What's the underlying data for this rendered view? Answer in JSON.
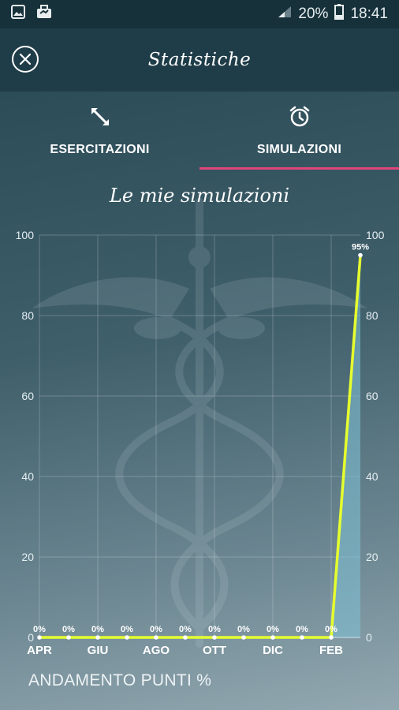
{
  "status_bar": {
    "battery": "20%",
    "time": "18:41",
    "icons": [
      "image-icon",
      "briefcase-notification-icon",
      "signal-icon",
      "battery-icon"
    ]
  },
  "header": {
    "title": "Statistiche",
    "close_icon": "close-icon"
  },
  "tabs": [
    {
      "label": "ESERCITAZIONI",
      "icon": "arrows-diagonal-icon",
      "selected": false
    },
    {
      "label": "SIMULAZIONI",
      "icon": "alarm-clock-icon",
      "selected": true
    }
  ],
  "section_title": "Le mie simulazioni",
  "footer_label": "ANDAMENTO PUNTI %",
  "colors": {
    "accent": "#e0457b",
    "line": "#e6ff2e",
    "area": "#7fc3d7"
  },
  "chart_data": {
    "type": "line",
    "title": "Le mie simulazioni",
    "xlabel": "ANDAMENTO PUNTI %",
    "ylabel": "",
    "ylim": [
      0,
      100
    ],
    "yticks": [
      "0",
      "20",
      "40",
      "60",
      "80",
      "100"
    ],
    "x_labels": [
      "APR",
      "",
      "GIU",
      "",
      "AGO",
      "",
      "OTT",
      "",
      "DIC",
      "",
      "FEB",
      ""
    ],
    "series": [
      {
        "values": [
          0,
          0,
          0,
          0,
          0,
          0,
          0,
          0,
          0,
          0,
          0,
          95
        ],
        "labels": [
          "0%",
          "0%",
          "0%",
          "0%",
          "0%",
          "0%",
          "0%",
          "0%",
          "0%",
          "0%",
          "0%",
          "95%"
        ]
      }
    ],
    "grid": true,
    "legend": "none"
  }
}
